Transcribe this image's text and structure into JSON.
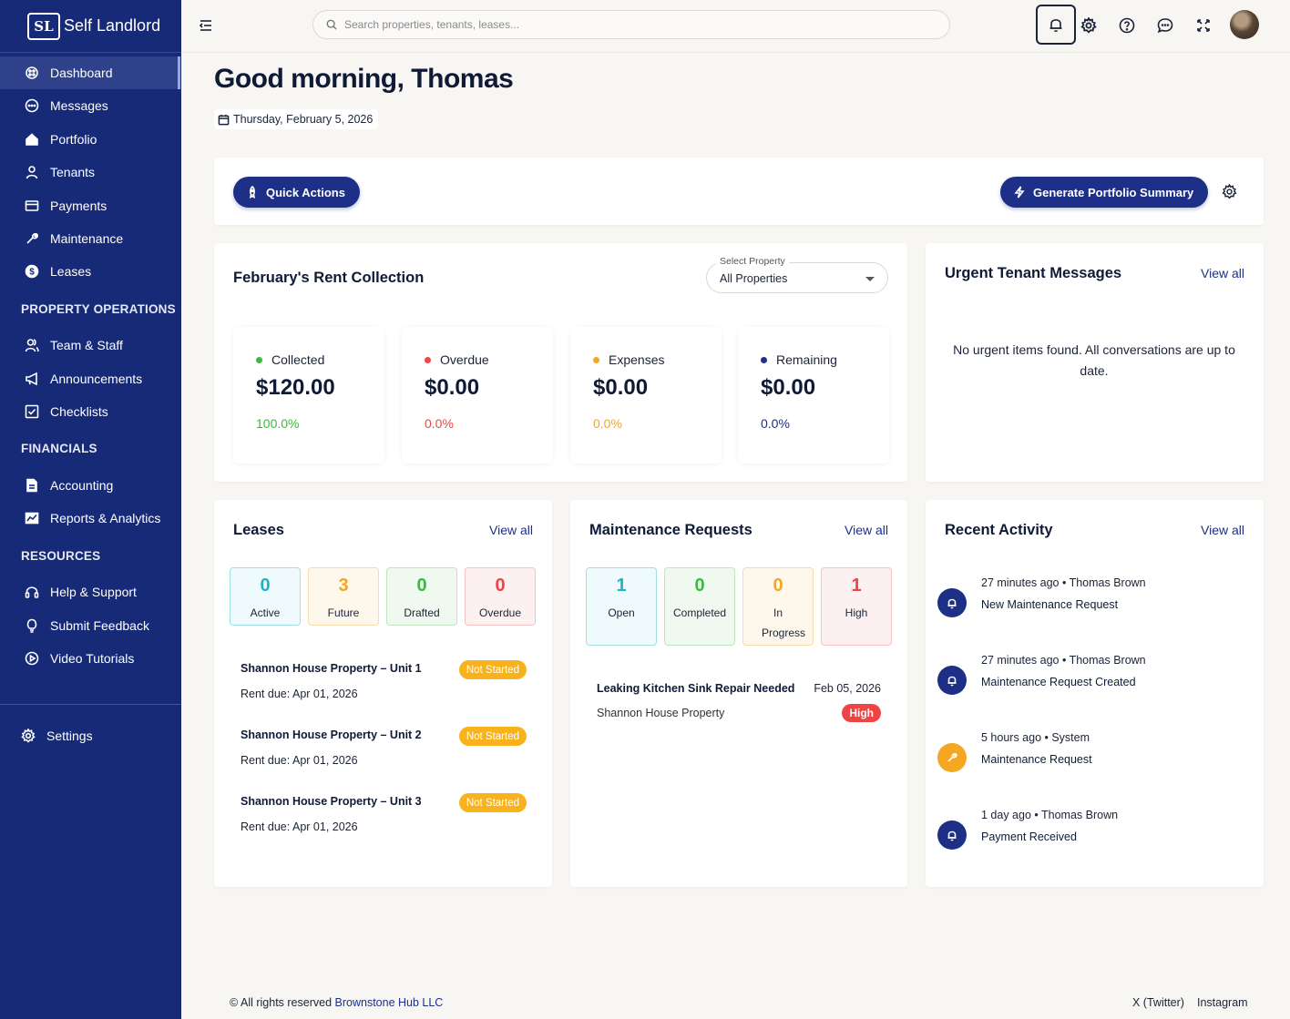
{
  "brand": {
    "logo_text": "SL",
    "name": "Self Landlord"
  },
  "sidebar": {
    "main": [
      {
        "label": "Dashboard",
        "icon": "dashboard-icon",
        "active": true
      },
      {
        "label": "Messages",
        "icon": "chat-icon"
      },
      {
        "label": "Portfolio",
        "icon": "home-icon"
      },
      {
        "label": "Tenants",
        "icon": "user-icon"
      },
      {
        "label": "Payments",
        "icon": "card-icon"
      },
      {
        "label": "Maintenance",
        "icon": "wrench-icon"
      },
      {
        "label": "Leases",
        "icon": "dollar-icon"
      }
    ],
    "sections": [
      {
        "title": "PROPERTY OPERATIONS"
      },
      {
        "title": "FINANCIALS"
      },
      {
        "title": "RESOURCES"
      }
    ],
    "operations": [
      {
        "label": "Team & Staff",
        "icon": "team-icon"
      },
      {
        "label": "Announcements",
        "icon": "megaphone-icon"
      },
      {
        "label": "Checklists",
        "icon": "checkbox-icon"
      }
    ],
    "financials": [
      {
        "label": "Accounting",
        "icon": "document-icon"
      },
      {
        "label": "Reports & Analytics",
        "icon": "chart-icon"
      }
    ],
    "resources": [
      {
        "label": "Help & Support",
        "icon": "headset-icon"
      },
      {
        "label": "Submit Feedback",
        "icon": "lightbulb-icon"
      },
      {
        "label": "Video Tutorials",
        "icon": "play-icon"
      }
    ],
    "settings": {
      "label": "Settings",
      "icon": "gear-icon"
    }
  },
  "topbar": {
    "search_placeholder": "Search properties, tenants, leases..."
  },
  "greeting": "Good morning, Thomas",
  "date": "Thursday, February 5, 2026",
  "actions": {
    "quick_actions": "Quick Actions",
    "generate_summary": "Generate Portfolio Summary"
  },
  "rent": {
    "title": "February's Rent Collection",
    "select_label": "Select Property",
    "select_value": "All Properties",
    "stats": [
      {
        "label": "Collected",
        "value": "$120.00",
        "pct": "100.0%",
        "color": "#3cba3c"
      },
      {
        "label": "Overdue",
        "value": "$0.00",
        "pct": "0.0%",
        "color": "#ef4444"
      },
      {
        "label": "Expenses",
        "value": "$0.00",
        "pct": "0.0%",
        "color": "#f5a623"
      },
      {
        "label": "Remaining",
        "value": "$0.00",
        "pct": "0.0%",
        "color": "#1d2f86"
      }
    ]
  },
  "urgent": {
    "title": "Urgent Tenant Messages",
    "view_all": "View all",
    "empty": "No urgent items found. All conversations are up to date."
  },
  "leases": {
    "title": "Leases",
    "view_all": "View all",
    "counters": [
      {
        "num": "0",
        "label": "Active",
        "color": "#1fb5c4",
        "bg": "#eefafb",
        "border": "#9fe0e7"
      },
      {
        "num": "3",
        "label": "Future",
        "color": "#f5a623",
        "bg": "#fef8ec",
        "border": "#f7dcab"
      },
      {
        "num": "0",
        "label": "Drafted",
        "color": "#3cba3c",
        "bg": "#eff9ef",
        "border": "#bfe5bf"
      },
      {
        "num": "0",
        "label": "Overdue",
        "color": "#ef4444",
        "bg": "#fdf0f0",
        "border": "#f5c2c2"
      }
    ],
    "items": [
      {
        "name": "Shannon House Property – Unit 1",
        "due": "Rent due: Apr 01, 2026",
        "status": "Not Started"
      },
      {
        "name": "Shannon House Property – Unit 2",
        "due": "Rent due: Apr 01, 2026",
        "status": "Not Started"
      },
      {
        "name": "Shannon House Property – Unit 3",
        "due": "Rent due: Apr 01, 2026",
        "status": "Not Started"
      }
    ]
  },
  "maintenance": {
    "title": "Maintenance Requests",
    "view_all": "View all",
    "counters": [
      {
        "num": "1",
        "label": "Open",
        "color": "#1fb5c4",
        "bg": "#eefafb",
        "border": "#9fe0e7"
      },
      {
        "num": "0",
        "label": "Completed",
        "color": "#3cba3c",
        "bg": "#eff9ef",
        "border": "#bfe5bf"
      },
      {
        "num": "0",
        "label": "In Progress",
        "color": "#f5a623",
        "bg": "#fef8ec",
        "border": "#f7dcab"
      },
      {
        "num": "1",
        "label": "High",
        "color": "#ef4444",
        "bg": "#fdf0f0",
        "border": "#f5c2c2"
      }
    ],
    "request": {
      "title": "Leaking Kitchen Sink Repair Needed",
      "date": "Feb 05, 2026",
      "property": "Shannon House Property",
      "priority": "High"
    }
  },
  "activity": {
    "title": "Recent Activity",
    "view_all": "View all",
    "items": [
      {
        "meta": "27 minutes ago • Thomas Brown",
        "title": "New Maintenance Request",
        "icon": "bell-icon",
        "color": "#1d2f86"
      },
      {
        "meta": "27 minutes ago • Thomas Brown",
        "title": "Maintenance Request Created",
        "icon": "bell-icon",
        "color": "#1d2f86"
      },
      {
        "meta": "5 hours ago • System",
        "title": "Maintenance Request",
        "icon": "wrench-icon",
        "color": "#f5a623"
      },
      {
        "meta": "1 day ago • Thomas Brown",
        "title": "Payment Received",
        "icon": "bell-icon",
        "color": "#1d2f86"
      }
    ]
  },
  "footer": {
    "copyright": "© All rights reserved",
    "company": "Brownstone Hub LLC",
    "links": [
      "X (Twitter)",
      "Instagram"
    ]
  }
}
